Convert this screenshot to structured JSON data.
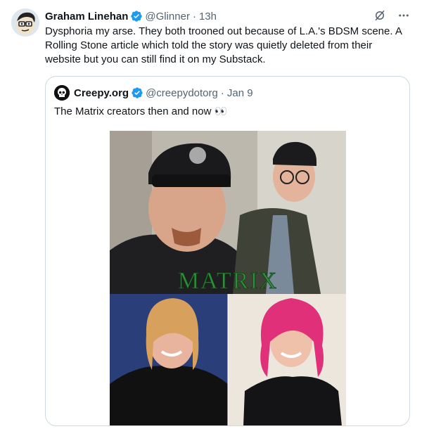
{
  "tweet": {
    "author_name": "Graham Linehan",
    "author_handle": "@Glinner",
    "time": "13h",
    "text": "Dysphoria my arse. They both trooned out because of L.A.'s BDSM scene. A Rolling Stone article which told the story was quietly deleted from their website but you can still find it on my Substack."
  },
  "quoted": {
    "author_name": "Creepy.org",
    "author_handle": "@creepydotorg",
    "time": "Jan 9",
    "text": "The Matrix creators then and now 👀",
    "image_overlay_text": "MATRIX"
  },
  "colors": {
    "verified_blue": "#1d9bf0",
    "muted_text": "#536471",
    "matrix_green": "#2f8f3a"
  },
  "icons": [
    "grok-icon",
    "more-icon",
    "verified-badge-icon",
    "skull-avatar-icon"
  ]
}
